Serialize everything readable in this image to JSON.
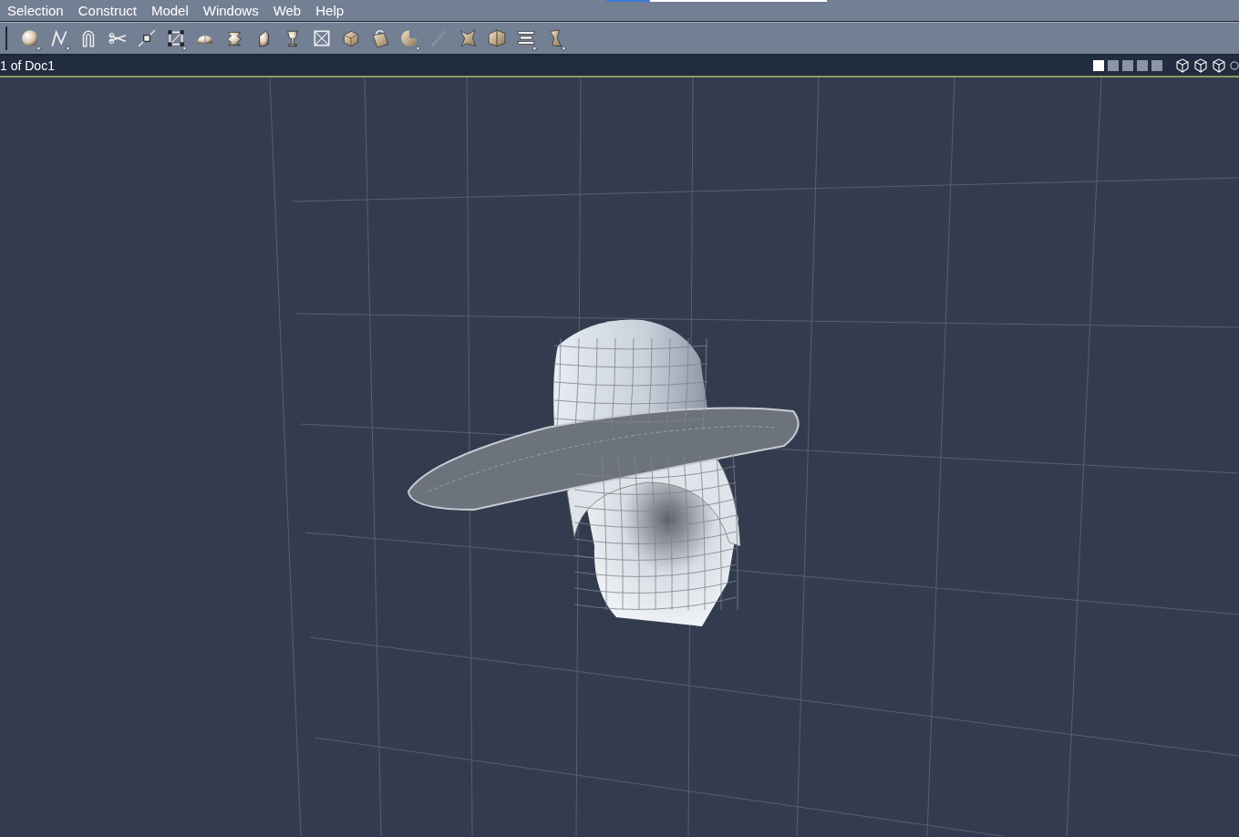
{
  "menu_bar": {
    "items": [
      "Selection",
      "Construct",
      "Model",
      "Windows",
      "Web",
      "Help"
    ]
  },
  "toolbar": {
    "tools": [
      {
        "has_menu": true,
        "disabled": false
      },
      {
        "has_menu": true,
        "disabled": false
      },
      {
        "has_menu": false,
        "disabled": false
      },
      {
        "has_menu": false,
        "disabled": false
      },
      {
        "has_menu": false,
        "disabled": false
      },
      {
        "has_menu": true,
        "disabled": false
      },
      {
        "has_menu": false,
        "disabled": false
      },
      {
        "has_menu": false,
        "disabled": false
      },
      {
        "has_menu": false,
        "disabled": false
      },
      {
        "has_menu": false,
        "disabled": false
      },
      {
        "has_menu": false,
        "disabled": false
      },
      {
        "has_menu": false,
        "disabled": false
      },
      {
        "has_menu": false,
        "disabled": false
      },
      {
        "has_menu": true,
        "disabled": false
      },
      {
        "has_menu": false,
        "disabled": true
      },
      {
        "has_menu": false,
        "disabled": false
      },
      {
        "has_menu": false,
        "disabled": false
      },
      {
        "has_menu": true,
        "disabled": false
      },
      {
        "has_menu": true,
        "disabled": false
      }
    ]
  },
  "viewport_bar": {
    "title": "1 of Doc1",
    "layouts": [
      {
        "selected": true
      },
      {
        "selected": false
      },
      {
        "selected": false
      },
      {
        "selected": false
      },
      {
        "selected": false
      }
    ]
  }
}
